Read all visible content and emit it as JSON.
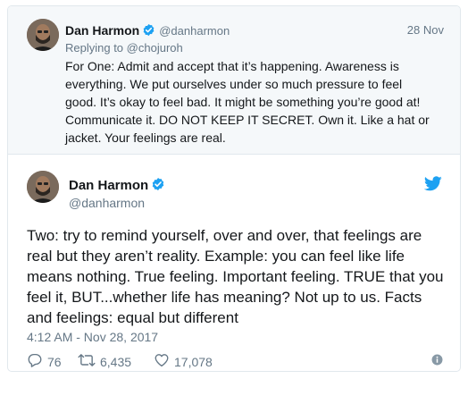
{
  "parent_tweet": {
    "display_name": "Dan Harmon",
    "handle": "@danharmon",
    "date": "28 Nov",
    "replying_prefix": "Replying to",
    "replying_to": "@chojuroh",
    "text": "For One: Admit and accept that it’s happening. Awareness is everything. We put ourselves under so much pressure to feel good. It’s okay to feel bad. It might be something you’re good at! Communicate it. DO NOT KEEP IT SECRET. Own it. Like a hat or jacket. Your feelings are real."
  },
  "main_tweet": {
    "display_name": "Dan Harmon",
    "handle": "@danharmon",
    "text": "Two: try to remind yourself, over and over, that feelings are real but they aren’t reality. Example: you can feel like life means nothing. True feeling. Important feeling. TRUE that you feel it, BUT...whether life has meaning? Not up to us. Facts and feelings: equal but different",
    "timestamp": "4:12 AM - Nov 28, 2017",
    "replies": "76",
    "retweets": "6,435",
    "likes": "17,078"
  },
  "icons": {
    "verified": "verified-badge-icon",
    "brand": "twitter-bird-icon",
    "reply": "reply-icon",
    "retweet": "retweet-icon",
    "like": "heart-icon",
    "info": "info-icon"
  },
  "colors": {
    "brand_blue": "#1da1f2",
    "muted_text": "#657786",
    "parent_bg": "#f5f8fa",
    "border": "#e1e8ed"
  }
}
